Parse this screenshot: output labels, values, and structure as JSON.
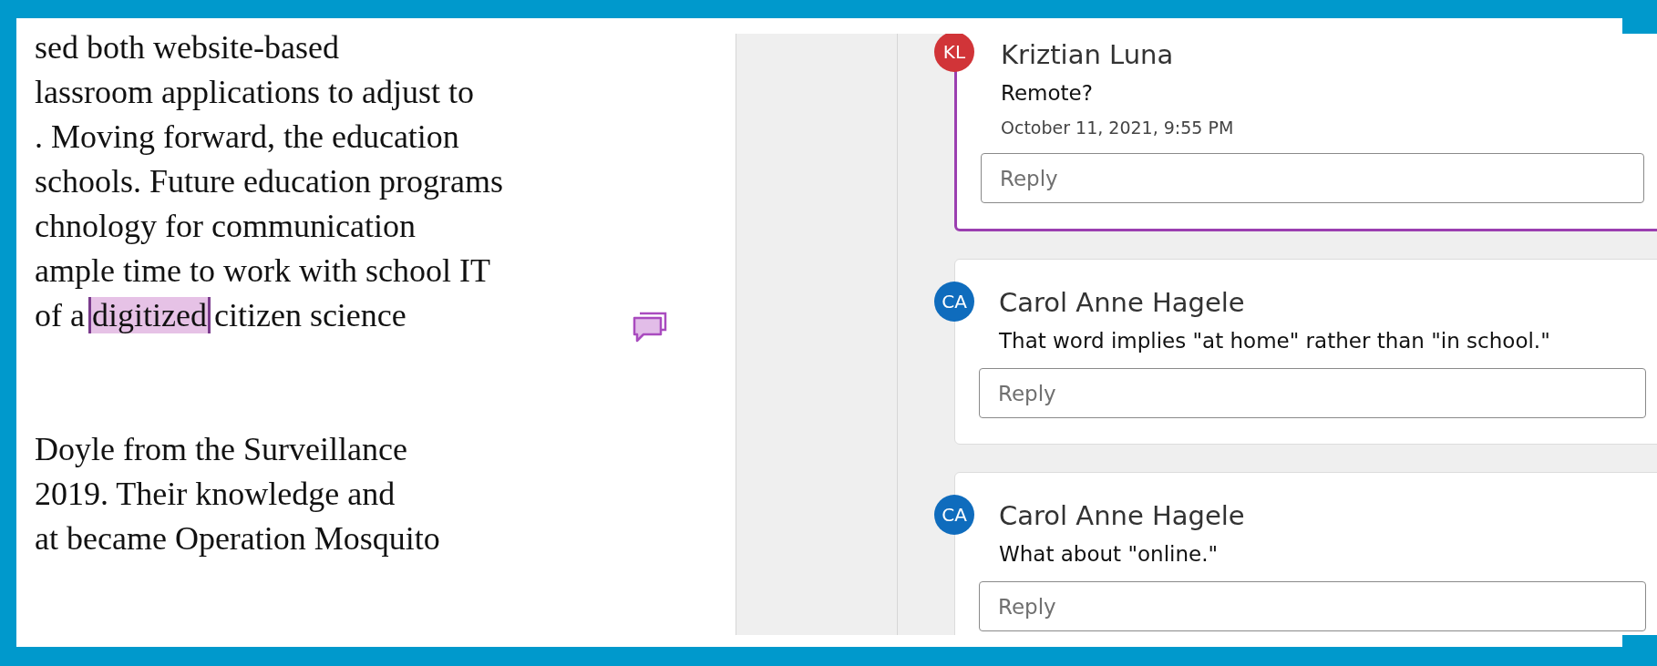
{
  "document": {
    "paragraphs": [
      {
        "lines": [
          {
            "text": "sed both website-based"
          },
          {
            "text": "lassroom applications to adjust to"
          },
          {
            "text": ". Moving forward, the education"
          },
          {
            "text": "schools. Future education programs"
          },
          {
            "text": "chnology for communication"
          },
          {
            "text": "ample time to work with school IT"
          },
          {
            "before": "of a",
            "highlighted": "digitized",
            "after": "citizen science"
          }
        ]
      },
      {
        "lines": [
          {
            "text": "Doyle from the Surveillance"
          },
          {
            "text": "2019. Their knowledge and"
          },
          {
            "text": "at became Operation Mosquito"
          }
        ]
      }
    ]
  },
  "comments": [
    {
      "initials": "KL",
      "color": "#d13438",
      "author": "Kriztian Luna",
      "text": "Remote?",
      "date": "October 11, 2021, 9:55 PM",
      "reply_placeholder": "Reply",
      "selected": true
    },
    {
      "initials": "CA",
      "color": "#0f6cbd",
      "author": "Carol Anne Hagele",
      "text": "That word implies \"at home\" rather than \"in school.\"",
      "reply_placeholder": "Reply",
      "selected": false
    },
    {
      "initials": "CA",
      "color": "#0f6cbd",
      "author": "Carol Anne Hagele",
      "text": "What about \"online.\"",
      "reply_placeholder": "Reply",
      "selected": false
    }
  ]
}
